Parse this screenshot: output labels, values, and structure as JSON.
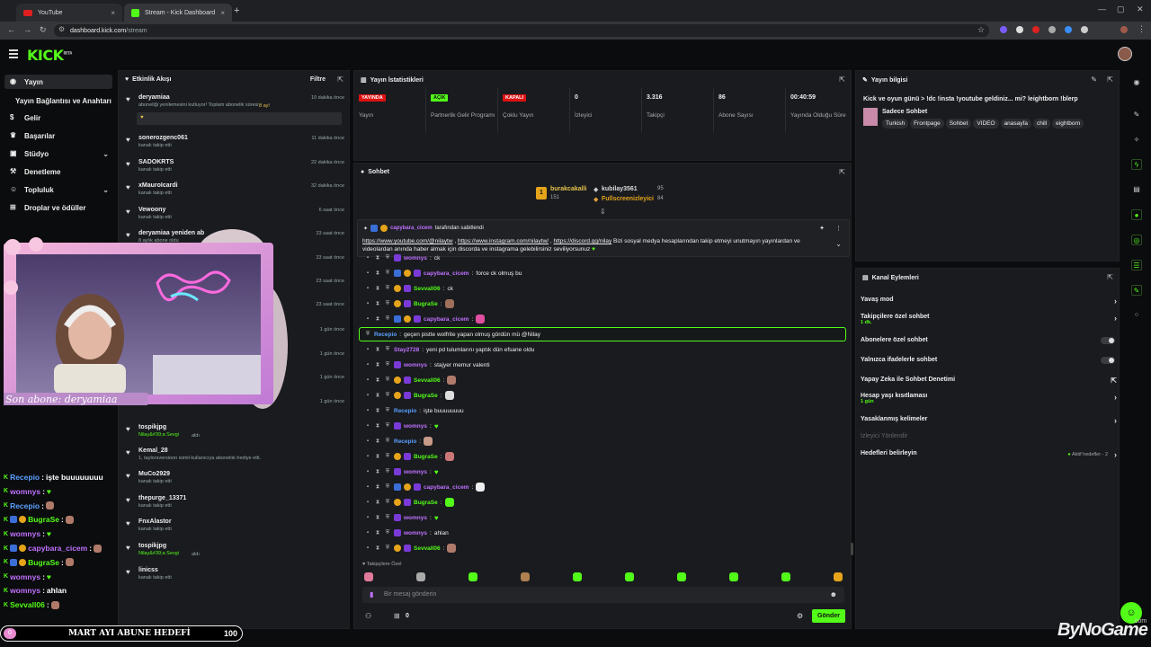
{
  "browser": {
    "tabs": [
      {
        "label": "YouTube"
      },
      {
        "label": "Stream - Kick Dashboard"
      }
    ],
    "address": {
      "host": "dashboard.kick.com",
      "path": "/stream"
    }
  },
  "kick": {
    "logo": "KICK",
    "logo_tag": "BETA"
  },
  "sidebar": {
    "items": [
      {
        "label": "Yayın",
        "icon": "broadcast-icon"
      },
      {
        "label": "Yayın Bağlantısı ve Anahtarı"
      },
      {
        "label": "Gelir",
        "icon": "money-icon"
      },
      {
        "label": "Başarılar",
        "icon": "trophy-icon"
      },
      {
        "label": "Stüdyo",
        "icon": "studio-icon"
      },
      {
        "label": "Denetleme",
        "icon": "gavel-icon"
      },
      {
        "label": "Topluluk",
        "icon": "community-icon"
      },
      {
        "label": "Droplar ve ödüller",
        "icon": "gift-icon"
      }
    ]
  },
  "activity": {
    "title": "Etkinlik Akışı",
    "filter": "Filtre",
    "items": [
      {
        "name": "deryamiaa",
        "sub": "aboneliği yenilemesini kutluyor! Toplam abonelik süresi - ",
        "subhl": "8 ay!",
        "time": "10 dakika önce",
        "msg": "♥"
      },
      {
        "name": "sonerozgenc061",
        "sub": "kanalı takip etti",
        "time": "11 dakika önce"
      },
      {
        "name": "SADOKRTS",
        "sub": "kanalı takip etti",
        "time": "22 dakika önce"
      },
      {
        "name": "xMauroIcardi",
        "sub": "kanalı takip etti",
        "time": "32 dakika önce"
      },
      {
        "name": "Vewoony",
        "sub": "kanalı takip etti",
        "time": "6 saat önce"
      },
      {
        "name": "deryamiaa yeniden ab",
        "sub": "8 aylık abone oldu",
        "time": "23 saat önce"
      },
      {
        "name": "",
        "sub": "",
        "time": "23 saat önce"
      },
      {
        "name": "",
        "sub": "",
        "time": "23 saat önce"
      },
      {
        "name": "",
        "sub": "",
        "time": "23 saat önce"
      },
      {
        "name": "",
        "sub": "",
        "time": "1 gün önce"
      },
      {
        "name": "",
        "sub": "",
        "time": "1 gün önce"
      },
      {
        "name": "",
        "sub": "",
        "time": "1 gün önce"
      },
      {
        "name": "",
        "sub": "",
        "time": "1 gün önce"
      },
      {
        "name": "tospikjpg",
        "sub": "Nilay&#39;a Sevgi",
        "subtail": " aldı",
        "time": ""
      },
      {
        "name": "Kemal_28",
        "sub": "1, taylorsversionn isimli kullanıcıya aboneliık hediye etti.",
        "time": ""
      },
      {
        "name": "MuCo2929",
        "sub": "kanalı takip etti",
        "time": ""
      },
      {
        "name": "thepurge_13371",
        "sub": "kanalı takip etti",
        "time": ""
      },
      {
        "name": "FnxAlastor",
        "sub": "kanalı takip etti",
        "time": ""
      },
      {
        "name": "tospikjpg",
        "sub": "Nilay&#39;a Sevgi",
        "subtail": " aldı",
        "time": ""
      },
      {
        "name": "linicss",
        "sub": "kanalı takip etti",
        "time": ""
      }
    ]
  },
  "stats": {
    "title": "Yayın İstatistikleri",
    "cells": [
      {
        "value": "YAYINDA",
        "label": "Yayın",
        "badge": "red"
      },
      {
        "value": "AÇIK",
        "label": "Partnerlik Gelir Programı",
        "badge": "green"
      },
      {
        "value": "KAPALI",
        "label": "Çoklu Yayın",
        "badge": "red"
      },
      {
        "value": "0",
        "label": "İzleyici"
      },
      {
        "value": "3.316",
        "label": "Takipçi"
      },
      {
        "value": "86",
        "label": "Abone Sayısı"
      },
      {
        "value": "00:40:59",
        "label": "Yayında Olduğu Süre"
      }
    ]
  },
  "chat": {
    "title": "Sohbet",
    "leaders": [
      {
        "name": "burakcakalli",
        "count": "151",
        "rank": "1"
      },
      {
        "name": "kubilay3561",
        "count": "95"
      },
      {
        "name": "Fullscreenizleyici",
        "count": "84"
      }
    ],
    "pinned": {
      "by": "capybara_cicem",
      "by_tail": "tarafından sabitlendi",
      "link1": "https://www.youtube.com/@nilaytw",
      "sep1": " , ",
      "link2": "https://www.instagram.com/nilaytw/",
      "sep2": " , ",
      "link3": "https://discord.gg/nilay",
      "text": " Bizi sosyal medya hesaplarından takip etmeyi unutmayın yayınlardan ve videolardan anında haber almak için discorda ve instagrama gelebilirsiniz seviliyorsunuz"
    },
    "messages": [
      {
        "user": "womnys",
        "color": "pur",
        "text": "ck",
        "badges": 1
      },
      {
        "user": "capybara_cicem",
        "color": "pur",
        "text": "force ck olmuş bu",
        "badges": 3
      },
      {
        "user": "Sevvall06",
        "color": "grn",
        "text": "ck",
        "badges": 2
      },
      {
        "user": "BugraSe",
        "color": "grn",
        "text": "",
        "emote": "#a0705a",
        "badges": 2
      },
      {
        "user": "capybara_cicem",
        "color": "pur",
        "text": "",
        "emote": "#e04fa0",
        "badges": 3
      },
      {
        "user": "Recepio",
        "color": "blu",
        "text": "geçen pistte wolfrite yapan olmuş gördün mü @Nilay",
        "badges": 0,
        "highlight": true
      },
      {
        "user": "Stay2728",
        "color": "pur",
        "text": "yeni pd tulumlarını yaptık dün efsane oldu",
        "badges": 0
      },
      {
        "user": "womnys",
        "color": "pur",
        "text": "stajyer memur valenti",
        "badges": 1
      },
      {
        "user": "Sevvall06",
        "color": "grn",
        "text": "",
        "emote": "#b07a6a",
        "badges": 2
      },
      {
        "user": "BugraSe",
        "color": "grn",
        "text": "",
        "emote": "#ddd",
        "badges": 2
      },
      {
        "user": "Recepio",
        "color": "blu",
        "text": "işte buuuuuuuu",
        "badges": 0
      },
      {
        "user": "womnys",
        "color": "pur",
        "text": "",
        "heart": "♥",
        "badges": 1
      },
      {
        "user": "Recepio",
        "color": "blu",
        "text": "",
        "emote": "#c89a88",
        "badges": 0
      },
      {
        "user": "BugraSe",
        "color": "grn",
        "text": "",
        "emote": "#c77",
        "badges": 2
      },
      {
        "user": "womnys",
        "color": "pur",
        "text": "",
        "heart": "♥",
        "badges": 1
      },
      {
        "user": "capybara_cicem",
        "color": "pur",
        "text": "",
        "emote": "#eee",
        "badges": 3
      },
      {
        "user": "BugraSe",
        "color": "grn",
        "text": "",
        "emote": "#53fc18",
        "badges": 2
      },
      {
        "user": "womnys",
        "color": "pur",
        "text": "",
        "heart": "♥",
        "badges": 1
      },
      {
        "user": "womnys",
        "color": "pur",
        "text": "ahlan",
        "badges": 1
      },
      {
        "user": "Sevvall06",
        "color": "grn",
        "text": "",
        "emote": "#b07a6a",
        "badges": 2
      }
    ],
    "emote_bar_label": "Takipçilere Özel",
    "input_placeholder": "Bir mesaj gönderin",
    "points": "0",
    "send": "Gönder"
  },
  "info": {
    "title": "Yayın bilgisi",
    "stream_title": "Kick ve oyun günü > !dc !insta !youtube geldiniz... mi? leightborn !blerp",
    "category": "Sadece Sohbet",
    "tags": [
      "Turkish",
      "Frontpage",
      "Sohbet",
      "VIDEO",
      "anasayfa",
      "chill",
      "eightborn"
    ]
  },
  "channel_actions": {
    "title": "Kanal Eylemleri",
    "items": [
      {
        "label": "Yavaş mod",
        "kind": "chevron"
      },
      {
        "label": "Takipçilere özel sohbet",
        "sub": "1 dk.",
        "kind": "chevron"
      },
      {
        "label": "Abonelere özel sohbet",
        "kind": "toggle"
      },
      {
        "label": "Yalnızca ifadelerle sohbet",
        "kind": "toggle"
      },
      {
        "label": "Yapay Zeka ile Sohbet Denetimi",
        "kind": "ext"
      },
      {
        "label": "Hesap yaşı kısıtlaması",
        "sub": "1 gün",
        "kind": "chevron"
      },
      {
        "label": "Yasaklanmış kelimeler",
        "kind": "chevron"
      },
      {
        "label": "İzleyici Yönlendir",
        "kind": "disabled"
      },
      {
        "label": "Hedefleri belirleyin",
        "kind": "goal",
        "right": "Aktif hedefler - 2"
      }
    ]
  },
  "overlay": {
    "sub_text": "Son abone: deryamiaa",
    "chat": [
      {
        "user": "Recepio",
        "text": "işte buuuuuuuu",
        "color": "#5aa0ff"
      },
      {
        "user": "womnys",
        "text": "",
        "heart": true,
        "color": "#c071ff"
      },
      {
        "user": "Recepio",
        "text": "",
        "emote": true,
        "color": "#5aa0ff"
      },
      {
        "user": "BugraSe",
        "text": "",
        "emote": true,
        "color": "#53fc18"
      },
      {
        "user": "womnys",
        "text": "",
        "heart": true,
        "color": "#c071ff"
      },
      {
        "user": "capybara_cicem",
        "text": "",
        "emote": true,
        "color": "#c071ff"
      },
      {
        "user": "BugraSe",
        "text": "",
        "emote": true,
        "color": "#53fc18"
      },
      {
        "user": "womnys",
        "text": "",
        "heart": true,
        "color": "#c071ff"
      },
      {
        "user": "womnys",
        "text": "ahlan",
        "color": "#c071ff"
      },
      {
        "user": "Sevvall06",
        "text": "",
        "emote": true,
        "color": "#53fc18"
      }
    ],
    "goal_label": "MART AYI ABUNE HEDEFİ",
    "goal_value": "100",
    "goal_start": "0",
    "watermark": "ByNoGame",
    "watermark_suffix": ".com"
  },
  "colors": {
    "brand": "#53fc18",
    "live": "#dd1111",
    "panel": "#191b1f"
  }
}
